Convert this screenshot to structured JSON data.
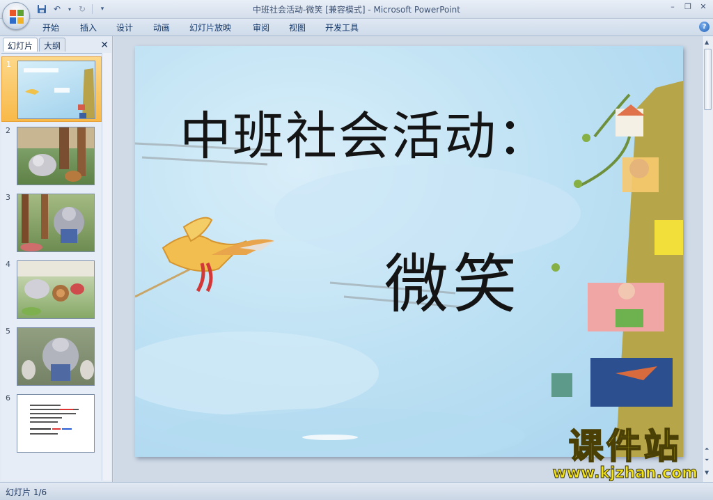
{
  "window": {
    "title": "中班社会活动-微笑 [兼容模式] - Microsoft PowerPoint"
  },
  "ribbon": {
    "tabs": [
      {
        "label": "开始"
      },
      {
        "label": "插入"
      },
      {
        "label": "设计"
      },
      {
        "label": "动画"
      },
      {
        "label": "幻灯片放映"
      },
      {
        "label": "审阅"
      },
      {
        "label": "视图"
      },
      {
        "label": "开发工具"
      }
    ],
    "help_icon": "?"
  },
  "left_panel": {
    "tab_slides": "幻灯片",
    "tab_outline": "大纲",
    "close_icon": "✕",
    "slides": [
      {
        "number": "1",
        "selected": true
      },
      {
        "number": "2"
      },
      {
        "number": "3"
      },
      {
        "number": "4"
      },
      {
        "number": "5"
      },
      {
        "number": "6"
      }
    ]
  },
  "slide": {
    "title": "中班社会活动：",
    "subtitle": "微笑"
  },
  "status": {
    "text": "幻灯片 1/6"
  },
  "watermark": {
    "name": "课件站",
    "url": "www.kjzhan.com"
  },
  "colors": {
    "accent_selected": "#f8b948",
    "ribbon_bg": "#dfe8f3",
    "watermark_yellow": "#f3e41a"
  }
}
